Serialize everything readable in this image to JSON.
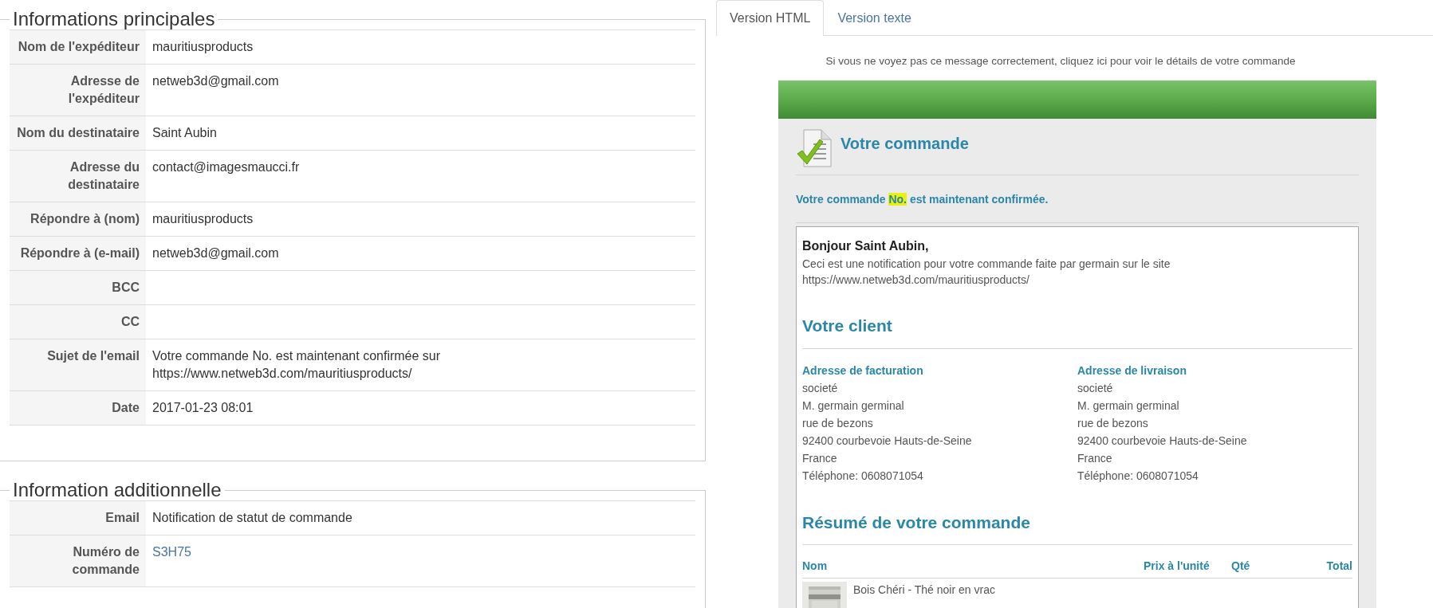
{
  "main_info": {
    "legend": "Informations principales",
    "rows": [
      {
        "label": "Nom de l'expéditeur",
        "value": "mauritiusproducts",
        "kind": "text"
      },
      {
        "label": "Adresse de l'expéditeur",
        "value": "netweb3d@gmail.com",
        "kind": "text"
      },
      {
        "label": "Nom du destinataire",
        "value": "Saint Aubin",
        "kind": "text"
      },
      {
        "label": "Adresse du destinataire",
        "value": "contact@imagesmaucci.fr",
        "kind": "text"
      },
      {
        "label": "Répondre à (nom)",
        "value": "mauritiusproducts",
        "kind": "text"
      },
      {
        "label": "Répondre à (e-mail)",
        "value": "netweb3d@gmail.com",
        "kind": "text"
      },
      {
        "label": "BCC"
      },
      {
        "label": "CC"
      },
      {
        "label": "Sujet de l'email",
        "value": "Votre commande No. est maintenant confirmée sur https://www.netweb3d.com/mauritiusproducts/",
        "kind": "text"
      },
      {
        "label": "Date",
        "value": "2017-01-23 08:01",
        "kind": "text"
      }
    ]
  },
  "additional_info": {
    "legend": "Information additionnelle",
    "rows": [
      {
        "label": "Email",
        "value": "Notification de statut de commande",
        "kind": "text"
      },
      {
        "label": "Numéro de commande",
        "value": "S3H75",
        "kind": "link"
      }
    ]
  },
  "tabs": [
    {
      "label": "Version HTML",
      "selected": true
    },
    {
      "label": "Version texte",
      "selected": false
    }
  ],
  "email": {
    "notice": "Si vous ne voyez pas ce message correctement, cliquez ici pour voir le détails de votre commande",
    "title": "Votre commande",
    "confirmation": {
      "before": "Votre commande ",
      "highlight": "No.",
      "after": " est maintenant confirmée."
    },
    "greeting": "Bonjour Saint Aubin,",
    "intro": "Ceci est une notification pour votre commande faite par germain sur le site https://www.netweb3d.com/mauritiusproducts/",
    "client_heading": "Votre client",
    "addresses": [
      {
        "heading": "Adresse de facturation",
        "lines": [
          "societé",
          "M. germain germinal",
          "rue de bezons",
          "92400 courbevoie Hauts-de-Seine",
          "France",
          "Téléphone: 0608071054"
        ]
      },
      {
        "heading": "Adresse de livraison",
        "lines": [
          "societé",
          "M. germain germinal",
          "rue de bezons",
          "92400 courbevoie Hauts-de-Seine",
          "France",
          "Téléphone: 0608071054"
        ]
      }
    ],
    "summary_heading": "Résumé de votre commande",
    "columns": [
      "Nom",
      "Prix à l'unité",
      "Qté",
      "Total"
    ],
    "items": [
      {
        "name": "Bois Chéri - Thé noir en vrac"
      }
    ]
  }
}
